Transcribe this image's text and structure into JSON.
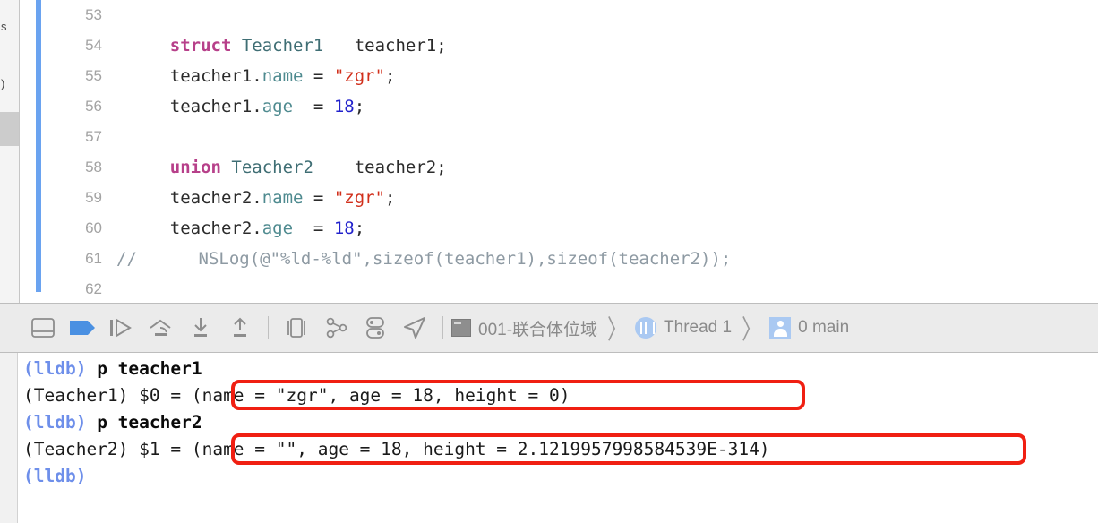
{
  "navigator": {
    "fragment_top": "s",
    "fragment_mid": ")"
  },
  "editor": {
    "clipped_top_line": "                                                                        ",
    "lines": [
      {
        "number": "53",
        "tokens": [
          {
            "t": "",
            "c": "plain"
          }
        ]
      },
      {
        "number": "54",
        "tokens": [
          {
            "t": "    ",
            "c": "plain"
          },
          {
            "t": "struct",
            "c": "kw"
          },
          {
            "t": " ",
            "c": "plain"
          },
          {
            "t": "Teacher1",
            "c": "type"
          },
          {
            "t": "   teacher1;",
            "c": "plain"
          }
        ]
      },
      {
        "number": "55",
        "tokens": [
          {
            "t": "    teacher1.",
            "c": "plain"
          },
          {
            "t": "name",
            "c": "prop"
          },
          {
            "t": " = ",
            "c": "plain"
          },
          {
            "t": "\"zgr\"",
            "c": "str"
          },
          {
            "t": ";",
            "c": "plain"
          }
        ]
      },
      {
        "number": "56",
        "tokens": [
          {
            "t": "    teacher1.",
            "c": "plain"
          },
          {
            "t": "age",
            "c": "prop"
          },
          {
            "t": "  = ",
            "c": "plain"
          },
          {
            "t": "18",
            "c": "num"
          },
          {
            "t": ";",
            "c": "plain"
          }
        ]
      },
      {
        "number": "57",
        "tokens": [
          {
            "t": "",
            "c": "plain"
          }
        ]
      },
      {
        "number": "58",
        "tokens": [
          {
            "t": "    ",
            "c": "plain"
          },
          {
            "t": "union",
            "c": "kw"
          },
          {
            "t": " ",
            "c": "plain"
          },
          {
            "t": "Teacher2",
            "c": "type"
          },
          {
            "t": "    teacher2;",
            "c": "plain"
          }
        ]
      },
      {
        "number": "59",
        "tokens": [
          {
            "t": "    teacher2.",
            "c": "plain"
          },
          {
            "t": "name",
            "c": "prop"
          },
          {
            "t": " = ",
            "c": "plain"
          },
          {
            "t": "\"zgr\"",
            "c": "str"
          },
          {
            "t": ";",
            "c": "plain"
          }
        ]
      },
      {
        "number": "60",
        "tokens": [
          {
            "t": "    teacher2.",
            "c": "plain"
          },
          {
            "t": "age",
            "c": "prop"
          },
          {
            "t": "  = ",
            "c": "plain"
          },
          {
            "t": "18",
            "c": "num"
          },
          {
            "t": ";",
            "c": "plain"
          }
        ]
      },
      {
        "number": "61",
        "indent": 0,
        "tokens": [
          {
            "t": "//      NSLog(@\"%ld-%ld\",sizeof(teacher1),sizeof(teacher2));",
            "c": "comment"
          }
        ]
      },
      {
        "number": "62",
        "tokens": [
          {
            "t": "",
            "c": "plain"
          }
        ]
      }
    ]
  },
  "debug_bar": {
    "icons": [
      {
        "name": "hide-debug-area-icon",
        "label": "Hide Debug Area"
      },
      {
        "name": "deactivate-breakpoints-icon",
        "label": "Deactivate Breakpoints"
      },
      {
        "name": "continue-execution-icon",
        "label": "Continue Program Execution"
      },
      {
        "name": "step-over-icon",
        "label": "Step Over"
      },
      {
        "name": "step-into-icon",
        "label": "Step Into"
      },
      {
        "name": "step-out-icon",
        "label": "Step Out"
      },
      {
        "name": "debug-view-hierarchy-icon",
        "label": "Debug View Hierarchy"
      },
      {
        "name": "debug-memory-graph-icon",
        "label": "Debug Memory Graph"
      },
      {
        "name": "environment-overrides-icon",
        "label": "Environment Overrides"
      },
      {
        "name": "simulate-location-icon",
        "label": "Simulate Location"
      }
    ],
    "breadcrumb": [
      {
        "label": "001-联合体位域",
        "icon": "project-icon"
      },
      {
        "label": "Thread 1",
        "icon": "thread-icon"
      },
      {
        "label": "0 main",
        "icon": "stack-frame-icon"
      }
    ],
    "chevron": "〉"
  },
  "console": {
    "lines": [
      {
        "segments": [
          {
            "t": "(lldb) ",
            "c": "prompt"
          },
          {
            "t": "p teacher1",
            "c": "cmd"
          }
        ]
      },
      {
        "segments": [
          {
            "t": "(Teacher1) $0 = ",
            "c": "res"
          },
          {
            "t": "(name = \"zgr\", age = 18, height = 0)",
            "c": "res"
          }
        ]
      },
      {
        "segments": [
          {
            "t": "(lldb) ",
            "c": "prompt"
          },
          {
            "t": "p teacher2",
            "c": "cmd"
          }
        ]
      },
      {
        "segments": [
          {
            "t": "(Teacher2) $1 = ",
            "c": "res"
          },
          {
            "t": "(name = \"\", age = 18, height = 2.1219957998584539E-314)",
            "c": "res"
          }
        ]
      },
      {
        "segments": [
          {
            "t": "(lldb)",
            "c": "prompt"
          }
        ]
      }
    ],
    "annotations": [
      {
        "name": "struct-result-highlight",
        "color": "#f01f12"
      },
      {
        "name": "union-result-highlight",
        "color": "#f01f12"
      }
    ]
  },
  "colors": {
    "annotation_red": "#f01f12",
    "keyword_magenta": "#b7408a",
    "type_teal": "#3f6e74",
    "string_red": "#d12f1b",
    "number_blue": "#2222cc",
    "comment_grey": "#8e9aa3",
    "lldb_prompt_blue": "#6e8fea",
    "change_bar_blue": "#6aa3f0"
  }
}
